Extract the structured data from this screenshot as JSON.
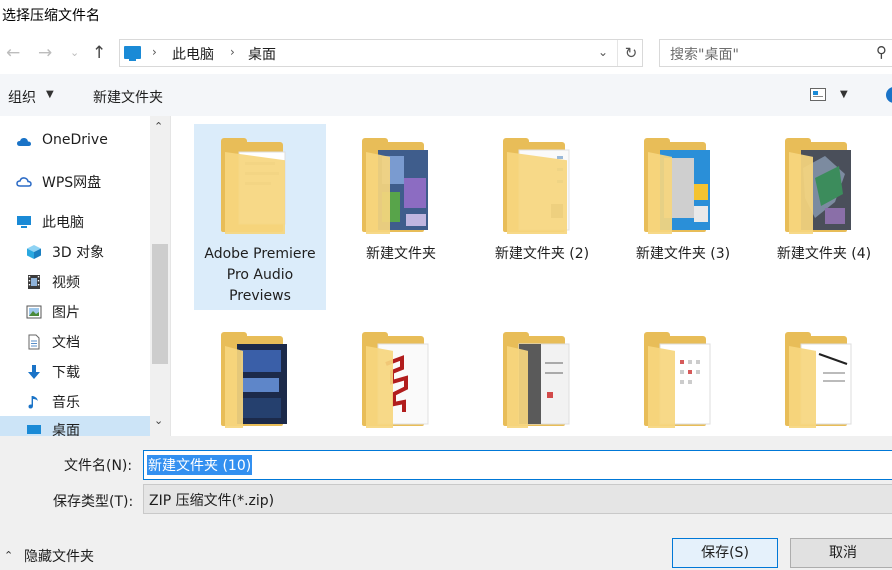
{
  "window": {
    "title": "选择压缩文件名"
  },
  "nav": {
    "back_icon": "arrow-left-icon",
    "forward_icon": "arrow-right-icon",
    "recent_icon": "chevron-down-icon",
    "up_icon": "arrow-up-icon",
    "breadcrumb": [
      "此电脑",
      "桌面"
    ],
    "search_placeholder": "搜索\"桌面\""
  },
  "toolbar": {
    "organize": "组织",
    "new_folder": "新建文件夹"
  },
  "sidebar": {
    "items": [
      {
        "label": "OneDrive",
        "icon": "cloud-icon"
      },
      {
        "label": "WPS网盘",
        "icon": "cloud-outline-icon"
      },
      {
        "label": "此电脑",
        "icon": "computer-icon"
      },
      {
        "label": "3D 对象",
        "icon": "cube-icon"
      },
      {
        "label": "视频",
        "icon": "film-icon"
      },
      {
        "label": "图片",
        "icon": "picture-icon"
      },
      {
        "label": "文档",
        "icon": "document-icon"
      },
      {
        "label": "下载",
        "icon": "download-arrow-icon"
      },
      {
        "label": "音乐",
        "icon": "music-note-icon"
      },
      {
        "label": "桌面",
        "icon": "desktop-icon"
      }
    ]
  },
  "files": [
    {
      "name": "Adobe Premiere Pro Audio Previews",
      "selected": true,
      "thumb": "documents"
    },
    {
      "name": "新建文件夹",
      "selected": false,
      "thumb": "game"
    },
    {
      "name": "新建文件夹 (2)",
      "selected": false,
      "thumb": "documents"
    },
    {
      "name": "新建文件夹 (3)",
      "selected": false,
      "thumb": "poster"
    },
    {
      "name": "新建文件夹 (4)",
      "selected": false,
      "thumb": "artwork"
    },
    {
      "name": "",
      "selected": false,
      "thumb": "poster-dark"
    },
    {
      "name": "",
      "selected": false,
      "thumb": "red-pattern"
    },
    {
      "name": "",
      "selected": false,
      "thumb": "grey-docs"
    },
    {
      "name": "",
      "selected": false,
      "thumb": "calendar"
    },
    {
      "name": "",
      "selected": false,
      "thumb": "white-doc"
    }
  ],
  "form": {
    "filename_label": "文件名(N):",
    "filename_value": "新建文件夹 (10)",
    "filetype_label": "保存类型(T):",
    "filetype_value": "ZIP 压缩文件(*.zip)",
    "hide_folders": "隐藏文件夹",
    "save": "保存(S)",
    "cancel": "取消"
  }
}
